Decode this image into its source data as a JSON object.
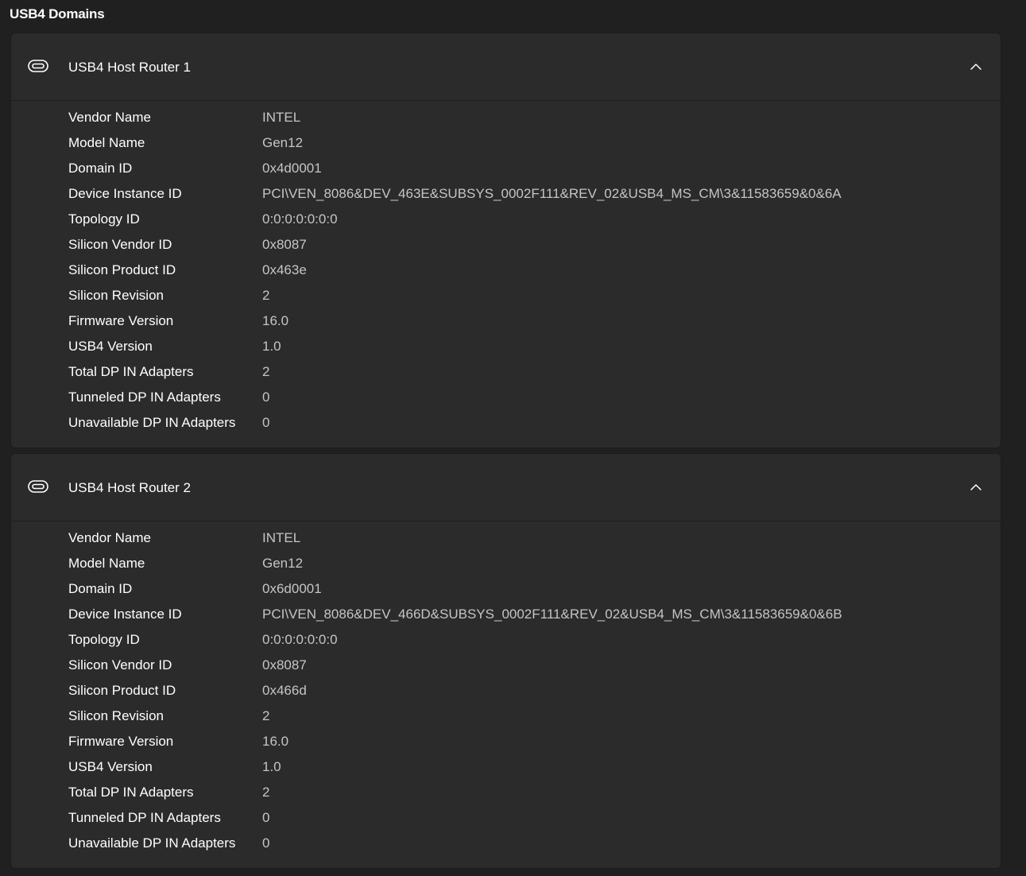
{
  "page": {
    "title": "USB4 Domains"
  },
  "routers": [
    {
      "title": "USB4 Host Router 1",
      "icon": "usb-c-port-icon",
      "expanded": true,
      "properties": [
        {
          "label": "Vendor Name",
          "value": "INTEL"
        },
        {
          "label": "Model Name",
          "value": "Gen12"
        },
        {
          "label": "Domain ID",
          "value": "0x4d0001"
        },
        {
          "label": "Device Instance ID",
          "value": "PCI\\VEN_8086&DEV_463E&SUBSYS_0002F111&REV_02&USB4_MS_CM\\3&11583659&0&6A"
        },
        {
          "label": "Topology ID",
          "value": "0:0:0:0:0:0:0"
        },
        {
          "label": "Silicon Vendor ID",
          "value": "0x8087"
        },
        {
          "label": "Silicon Product ID",
          "value": "0x463e"
        },
        {
          "label": "Silicon Revision",
          "value": "2"
        },
        {
          "label": "Firmware Version",
          "value": "16.0"
        },
        {
          "label": "USB4 Version",
          "value": "1.0"
        },
        {
          "label": "Total DP IN Adapters",
          "value": "2"
        },
        {
          "label": "Tunneled DP IN Adapters",
          "value": "0"
        },
        {
          "label": "Unavailable DP IN Adapters",
          "value": "0"
        }
      ]
    },
    {
      "title": "USB4 Host Router 2",
      "icon": "usb-c-port-icon",
      "expanded": true,
      "properties": [
        {
          "label": "Vendor Name",
          "value": "INTEL"
        },
        {
          "label": "Model Name",
          "value": "Gen12"
        },
        {
          "label": "Domain ID",
          "value": "0x6d0001"
        },
        {
          "label": "Device Instance ID",
          "value": "PCI\\VEN_8086&DEV_466D&SUBSYS_0002F111&REV_02&USB4_MS_CM\\3&11583659&0&6B"
        },
        {
          "label": "Topology ID",
          "value": "0:0:0:0:0:0:0"
        },
        {
          "label": "Silicon Vendor ID",
          "value": "0x8087"
        },
        {
          "label": "Silicon Product ID",
          "value": "0x466d"
        },
        {
          "label": "Silicon Revision",
          "value": "2"
        },
        {
          "label": "Firmware Version",
          "value": "16.0"
        },
        {
          "label": "USB4 Version",
          "value": "1.0"
        },
        {
          "label": "Total DP IN Adapters",
          "value": "2"
        },
        {
          "label": "Tunneled DP IN Adapters",
          "value": "0"
        },
        {
          "label": "Unavailable DP IN Adapters",
          "value": "0"
        }
      ]
    }
  ],
  "colors": {
    "background": "#202020",
    "card": "#2b2b2b",
    "label_text": "#ffffff",
    "value_text": "#c5c5c5"
  }
}
